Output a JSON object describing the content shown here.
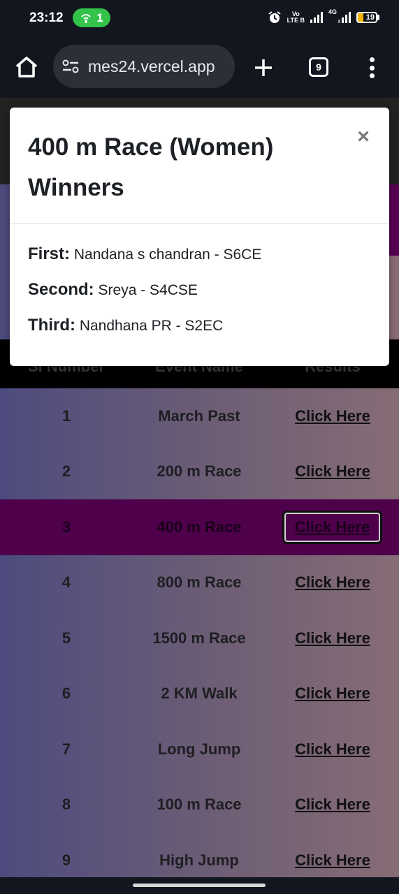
{
  "status_bar": {
    "time": "23:12",
    "hotspot_count": "1",
    "volte_line1": "Vo",
    "volte_line2": "LTE B",
    "network": "4G",
    "battery": "19"
  },
  "browser": {
    "url": "mes24.vercel.app",
    "tab_count": "9"
  },
  "table": {
    "headers": [
      "Sl Number",
      "Event Name",
      "Results"
    ],
    "rows": [
      {
        "num": "1",
        "event": "March Past",
        "result": "Click Here"
      },
      {
        "num": "2",
        "event": "200 m Race",
        "result": "Click Here"
      },
      {
        "num": "3",
        "event": "400 m Race",
        "result": "Click Here"
      },
      {
        "num": "4",
        "event": "800 m Race",
        "result": "Click Here"
      },
      {
        "num": "5",
        "event": "1500 m Race",
        "result": "Click Here"
      },
      {
        "num": "6",
        "event": "2 KM Walk",
        "result": "Click Here"
      },
      {
        "num": "7",
        "event": "Long Jump",
        "result": "Click Here"
      },
      {
        "num": "8",
        "event": "100 m Race",
        "result": "Click Here"
      },
      {
        "num": "9",
        "event": "High Jump",
        "result": "Click Here"
      }
    ]
  },
  "modal": {
    "title": "400 m Race (Women) Winners",
    "close": "×",
    "winners": [
      {
        "label": "First:",
        "name": "Nandana s chandran - S6CE"
      },
      {
        "label": "Second:",
        "name": "Sreya - S4CSE"
      },
      {
        "label": "Third:",
        "name": "Nandhana PR - S2EC"
      }
    ]
  },
  "colors": {
    "accent_purple": "#560052",
    "hotspot_green": "#33c24a",
    "battery_yellow": "#f4b400"
  }
}
